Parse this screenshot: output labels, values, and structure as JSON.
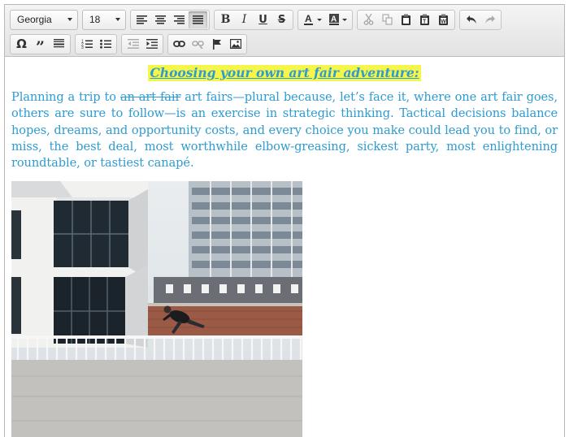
{
  "toolbar": {
    "font_family": "Georgia",
    "font_size": "18"
  },
  "document": {
    "heading": "Choosing your own art fair adventure:",
    "paragraph": {
      "lead": "Planning a trip to ",
      "struck": "an art fair",
      "rest": " art fairs—plural because, let’s face it, where one art fair goes, others are sure to follow—is an exercise in strategic thinking. Tactical decisions balance hopes, dreams, and opportunity costs, and every choice you make could lead you to find, or miss, the best deal, most worthwhile elbow-greasing, sickest party, most enlightening roundtable, or tastiest canapé."
    }
  },
  "colors": {
    "text": "#2e9bd2",
    "highlight": "#f5f54a"
  },
  "icons": [
    "align-left-icon",
    "align-center-icon",
    "align-right-icon",
    "align-justify-icon",
    "bold-icon",
    "italic-icon",
    "underline-icon",
    "strikethrough-icon",
    "text-color-icon",
    "background-color-icon",
    "cut-icon",
    "copy-icon",
    "paste-icon",
    "paste-text-icon",
    "paste-word-icon",
    "undo-icon",
    "redo-icon",
    "special-character-icon",
    "blockquote-icon",
    "horizontal-rule-icon",
    "numbered-list-icon",
    "bulleted-list-icon",
    "outdent-icon",
    "indent-icon",
    "link-icon",
    "unlink-icon",
    "anchor-flag-icon",
    "image-icon"
  ]
}
